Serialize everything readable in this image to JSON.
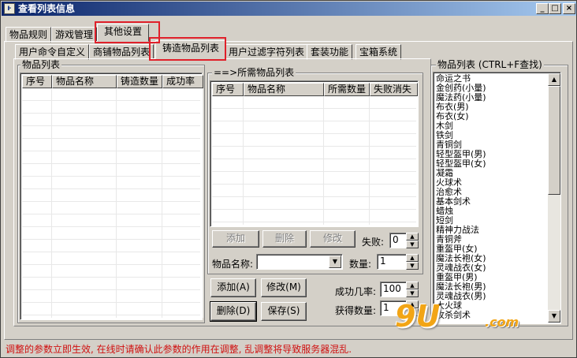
{
  "window": {
    "title": "查看列表信息",
    "app_icon_glyph": "ⱶ",
    "minimize": "_",
    "maximize": "□",
    "close": "×"
  },
  "main_tabs": [
    "物品规则",
    "游戏管理",
    "其他设置"
  ],
  "sub_tabs": [
    "用户命令自定义",
    "商铺物品列表",
    "铸造物品列表",
    "用户过滤字符列表",
    "套装功能",
    "宝箱系统"
  ],
  "left_list": {
    "label": "物品列表",
    "columns": [
      "序号",
      "物品名称",
      "铸造数量",
      "成功率"
    ]
  },
  "required_list": {
    "label": "==>所需物品列表",
    "columns": [
      "序号",
      "物品名称",
      "所需数量",
      "失败消失"
    ]
  },
  "required_buttons": {
    "add": "添加",
    "delete": "删除",
    "modify": "修改"
  },
  "lost": {
    "label": "失败:",
    "value": "0"
  },
  "item_name": {
    "label": "物品名称:",
    "value": ""
  },
  "quantity": {
    "label": "数量:",
    "value": "1"
  },
  "main_buttons": {
    "add": "添加(A)",
    "modify": "修改(M)",
    "delete": "删除(D)",
    "save": "保存(S)"
  },
  "success_rate": {
    "label": "成功几率:",
    "value": "100"
  },
  "obtain_count": {
    "label": "获得数量:",
    "value": "1"
  },
  "items_panel": {
    "label": "物品列表 (CTRL+F查找)",
    "items": [
      "命运之书",
      "金创药(小量)",
      "魔法药(小量)",
      "布衣(男)",
      "布衣(女)",
      "木剑",
      "铁剑",
      "青铜剑",
      "轻型盔甲(男)",
      "轻型盔甲(女)",
      "凝霜",
      "火球术",
      "治愈术",
      "基本剑术",
      "蜡烛",
      "短剑",
      "精神力战法",
      "青铜斧",
      "重盔甲(女)",
      "魔法长袍(女)",
      "灵魂战衣(女)",
      "重盔甲(男)",
      "魔法长袍(男)",
      "灵魂战衣(男)",
      "大火球",
      "攻杀剑术"
    ]
  },
  "status_message": "调整的参数立即生效, 在线时请确认此参数的作用在调整, 乱调整将导致服务器混乱.",
  "watermark": {
    "big": "9U",
    "small": ".com"
  },
  "colors": {
    "highlight": "#e0202a",
    "status": "#d01010",
    "titlebar": "#0a246a",
    "watermark": "#f2a516"
  }
}
